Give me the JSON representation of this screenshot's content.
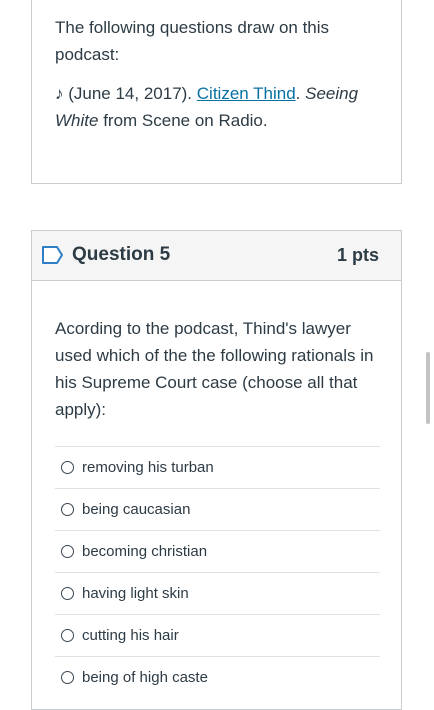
{
  "intro": {
    "line1": "The following questions draw on this podcast:",
    "citation_prefix": "♪ (June 14, 2017). ",
    "citation_link": "Citizen Thind",
    "citation_sep": ". ",
    "citation_title": "Seeing White",
    "citation_suffix": " from Scene on Radio."
  },
  "question": {
    "title": "Question 5",
    "points": "1 pts",
    "text": "Acording to the podcast, Thind's lawyer used which of the the following rationals in his Supreme Court case (choose all that apply):",
    "answers": [
      "removing his turban",
      "being caucasian",
      "becoming christian",
      "having light skin",
      "cutting his hair",
      "being of high caste"
    ]
  },
  "icons": {
    "flag": "bookmark-flag-icon",
    "radio": "radio-unchecked-icon"
  },
  "colors": {
    "link": "#0770a3",
    "flag_accent": "#2d7ec4",
    "header_bg": "#f5f5f5",
    "border": "#c7cdd1"
  }
}
